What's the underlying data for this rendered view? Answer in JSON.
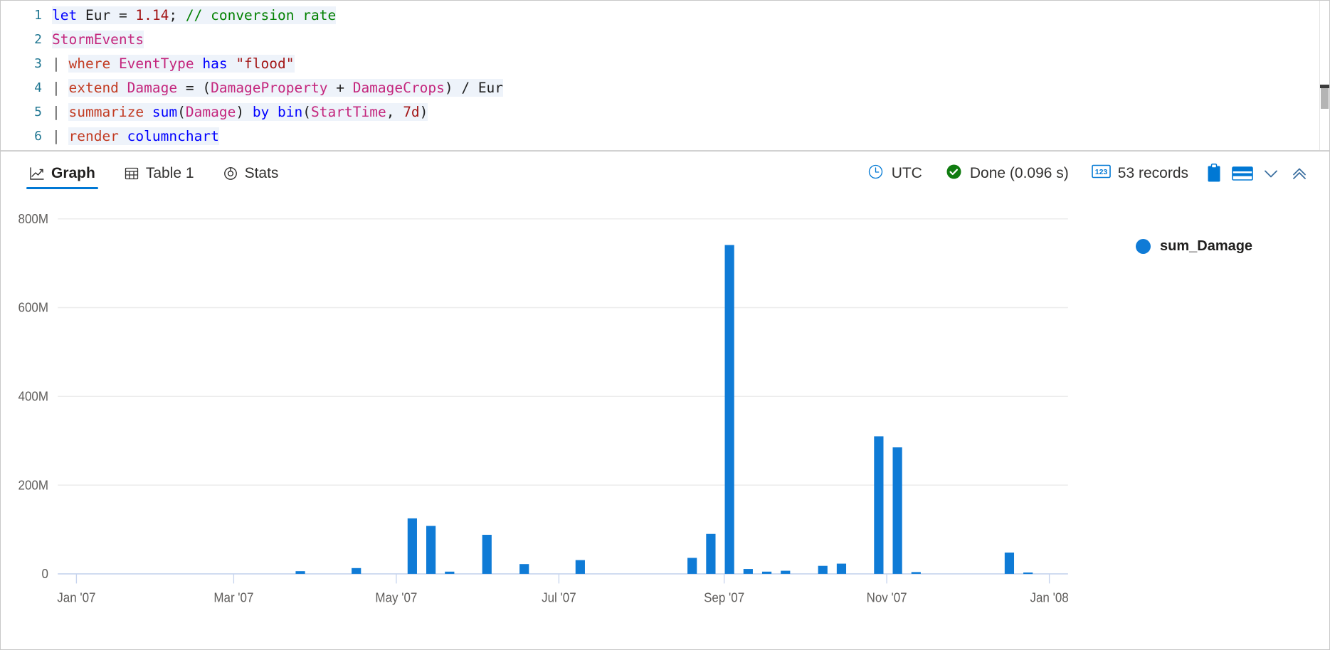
{
  "editor": {
    "lines": [
      {
        "number": "1",
        "tokens": [
          {
            "t": "let ",
            "c": "kw",
            "hl": true
          },
          {
            "t": "Eur ",
            "c": "plain",
            "hl": true
          },
          {
            "t": "= ",
            "c": "plain",
            "hl": true
          },
          {
            "t": "1.14",
            "c": "num",
            "hl": true
          },
          {
            "t": "; ",
            "c": "plain",
            "hl": true
          },
          {
            "t": "// conversion rate",
            "c": "com",
            "hl": true
          }
        ]
      },
      {
        "number": "2",
        "tokens": [
          {
            "t": "StormEvents",
            "c": "tbl",
            "hl": true
          }
        ]
      },
      {
        "number": "3",
        "tokens": [
          {
            "t": "| ",
            "c": "pipe",
            "hl": false
          },
          {
            "t": "where ",
            "c": "cmd",
            "hl": true
          },
          {
            "t": "EventType ",
            "c": "col",
            "hl": true
          },
          {
            "t": "has ",
            "c": "kw",
            "hl": true
          },
          {
            "t": "\"flood\"",
            "c": "str",
            "hl": true
          }
        ]
      },
      {
        "number": "4",
        "tokens": [
          {
            "t": "| ",
            "c": "pipe",
            "hl": false
          },
          {
            "t": "extend ",
            "c": "cmd",
            "hl": true
          },
          {
            "t": "Damage ",
            "c": "col",
            "hl": true
          },
          {
            "t": "= ",
            "c": "plain",
            "hl": true
          },
          {
            "t": "(",
            "c": "plain",
            "hl": true
          },
          {
            "t": "DamageProperty",
            "c": "col",
            "hl": true
          },
          {
            "t": " + ",
            "c": "plain",
            "hl": true
          },
          {
            "t": "DamageCrops",
            "c": "col",
            "hl": true
          },
          {
            "t": ") / ",
            "c": "plain",
            "hl": true
          },
          {
            "t": "Eur",
            "c": "plain",
            "hl": true
          }
        ]
      },
      {
        "number": "5",
        "tokens": [
          {
            "t": "| ",
            "c": "pipe",
            "hl": false
          },
          {
            "t": "summarize ",
            "c": "cmd",
            "hl": true
          },
          {
            "t": "sum",
            "c": "fn",
            "hl": true
          },
          {
            "t": "(",
            "c": "plain",
            "hl": true
          },
          {
            "t": "Damage",
            "c": "col",
            "hl": true
          },
          {
            "t": ") ",
            "c": "plain",
            "hl": true
          },
          {
            "t": "by ",
            "c": "kw",
            "hl": true
          },
          {
            "t": "bin",
            "c": "fn",
            "hl": true
          },
          {
            "t": "(",
            "c": "plain",
            "hl": true
          },
          {
            "t": "StartTime",
            "c": "col",
            "hl": true
          },
          {
            "t": ", ",
            "c": "plain",
            "hl": true
          },
          {
            "t": "7d",
            "c": "num",
            "hl": true
          },
          {
            "t": ")",
            "c": "plain",
            "hl": true
          }
        ]
      },
      {
        "number": "6",
        "tokens": [
          {
            "t": "| ",
            "c": "pipe",
            "hl": false
          },
          {
            "t": "render ",
            "c": "cmd",
            "hl": true
          },
          {
            "t": "columnchart",
            "c": "fn",
            "hl": true
          }
        ]
      }
    ]
  },
  "toolbar": {
    "tabs": [
      {
        "label": "Graph",
        "icon": "line-chart-icon",
        "active": true
      },
      {
        "label": "Table 1",
        "icon": "table-icon",
        "active": false
      },
      {
        "label": "Stats",
        "icon": "donut-chart-icon",
        "active": false
      }
    ],
    "timezone": "UTC",
    "timezone_icon": "clock-icon",
    "status": "Done (0.096 s)",
    "status_icon": "check-circle-icon",
    "status_color": "#107c10",
    "records": "53 records",
    "records_icon": "123-badge-icon",
    "buttons": [
      {
        "name": "copy-to-clipboard-button",
        "icon": "clipboard-icon"
      },
      {
        "name": "table-layout-button",
        "icon": "rows-icon"
      },
      {
        "name": "more-options-button",
        "icon": "chevron-down-icon"
      },
      {
        "name": "collapse-panel-button",
        "icon": "double-chevron-up-icon"
      }
    ]
  },
  "legend": {
    "series_label": "sum_Damage",
    "color": "#0f7bd6"
  },
  "chart_data": {
    "type": "bar",
    "title": "",
    "xlabel": "",
    "ylabel": "",
    "ylim": [
      0,
      800000000
    ],
    "grid": true,
    "legend_position": "right",
    "accent_color": "#0f7bd6",
    "ytick_labels": [
      "0",
      "200M",
      "400M",
      "600M",
      "800M"
    ],
    "ytick_values": [
      0,
      200000000,
      400000000,
      600000000,
      800000000
    ],
    "xtick_labels": [
      "Jan '07",
      "Mar '07",
      "May '07",
      "Jul '07",
      "Sep '07",
      "Nov '07",
      "Jan '08"
    ],
    "xtick_positions": [
      0,
      59,
      120,
      181,
      243,
      304,
      365
    ],
    "x_range_days": [
      -7,
      372
    ],
    "series": [
      {
        "name": "sum_Damage",
        "x_days": [
          0,
          7,
          14,
          21,
          28,
          35,
          42,
          49,
          56,
          63,
          70,
          77,
          84,
          91,
          98,
          105,
          112,
          119,
          126,
          133,
          140,
          147,
          154,
          161,
          168,
          175,
          182,
          189,
          196,
          203,
          210,
          217,
          224,
          231,
          238,
          245,
          252,
          259,
          266,
          273,
          280,
          287,
          294,
          301,
          308,
          315,
          322,
          329,
          336,
          343,
          350,
          357,
          364
        ],
        "values": [
          0,
          0,
          0,
          0,
          0,
          0,
          0,
          0,
          0,
          0,
          0,
          0,
          6000000,
          0,
          0,
          13000000,
          0,
          0,
          125000000,
          108000000,
          5000000,
          0,
          88000000,
          0,
          22000000,
          0,
          0,
          31000000,
          0,
          0,
          0,
          0,
          0,
          36000000,
          90000000,
          741000000,
          11000000,
          5000000,
          7000000,
          0,
          18000000,
          23000000,
          0,
          310000000,
          285000000,
          4000000,
          0,
          0,
          0,
          0,
          48000000,
          3000000,
          0
        ]
      }
    ]
  }
}
